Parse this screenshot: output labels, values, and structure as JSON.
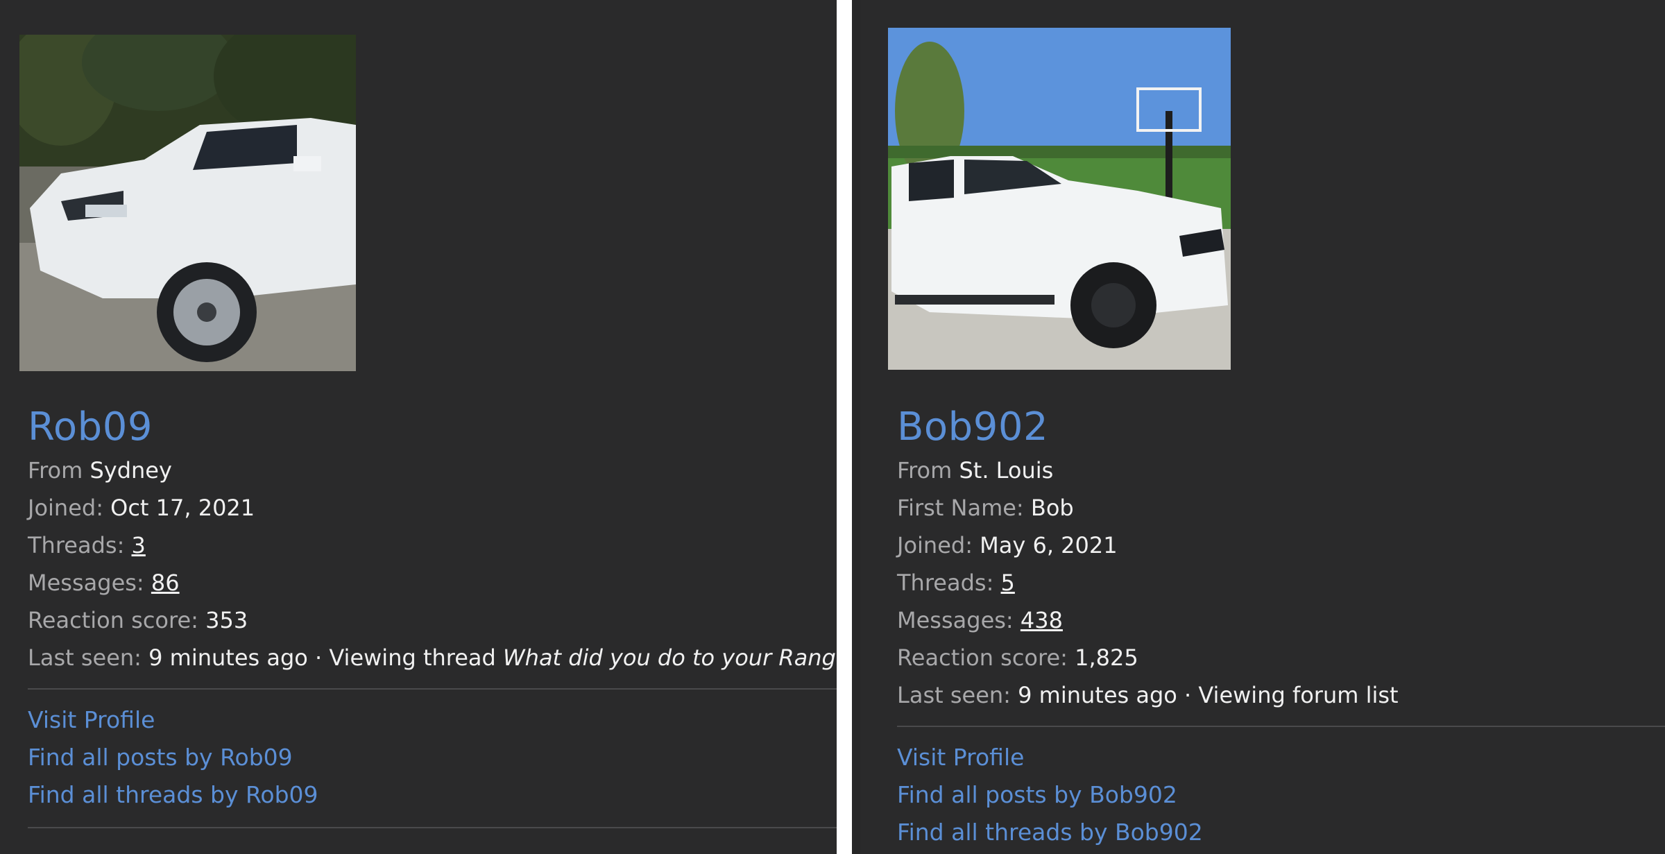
{
  "cards": [
    {
      "username": "Rob09",
      "from_label": "From",
      "from_value": "Sydney",
      "fields": [
        {
          "label": "Joined:",
          "value": "Oct 17, 2021"
        },
        {
          "label": "Threads:",
          "value": "3"
        },
        {
          "label": "Messages:",
          "value": "86"
        },
        {
          "label": "Reaction score:",
          "value": "353"
        }
      ],
      "last_seen": {
        "label": "Last seen:",
        "time": "9 minutes ago",
        "separator": "·",
        "activity": "Viewing thread",
        "thread_title": "What did you do to your Rang"
      },
      "links": {
        "visit_profile": "Visit Profile",
        "find_posts": "Find all posts by Rob09",
        "find_threads": "Find all threads by Rob09"
      }
    },
    {
      "username": "Bob902",
      "from_label": "From",
      "from_value": "St. Louis",
      "fields": [
        {
          "label": "First Name:",
          "value": "Bob"
        },
        {
          "label": "Joined:",
          "value": "May 6, 2021"
        },
        {
          "label": "Threads:",
          "value": "5"
        },
        {
          "label": "Messages:",
          "value": "438"
        },
        {
          "label": "Reaction score:",
          "value": "1,825"
        }
      ],
      "last_seen": {
        "label": "Last seen:",
        "time": "9 minutes ago",
        "separator": "·",
        "activity": "Viewing forum list"
      },
      "links": {
        "visit_profile": "Visit Profile",
        "find_posts": "Find all posts by Bob902",
        "find_threads": "Find all threads by Bob902"
      }
    }
  ]
}
